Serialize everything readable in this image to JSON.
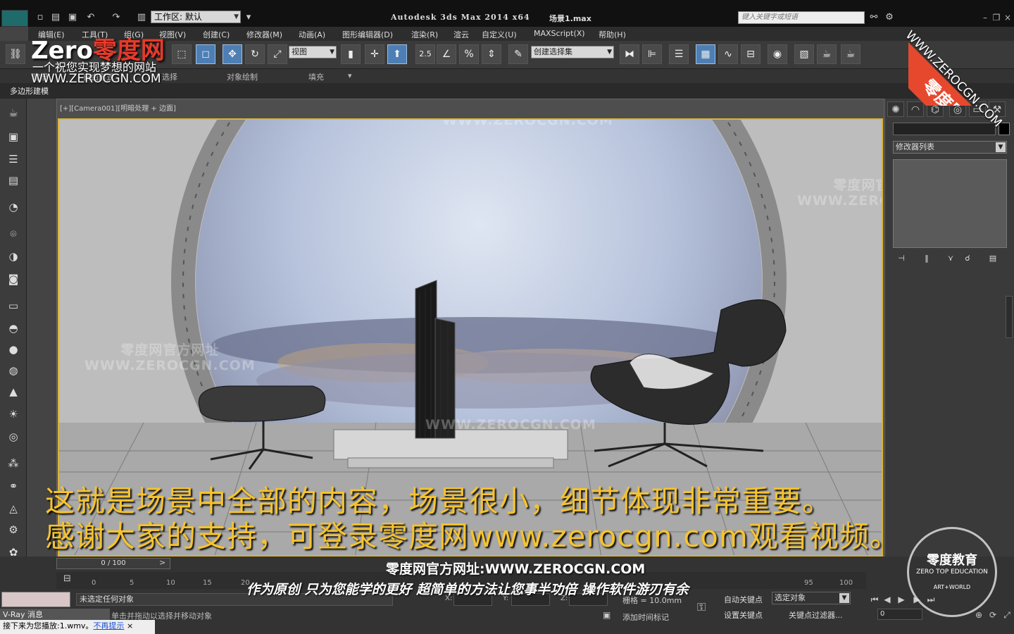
{
  "titlebar": {
    "workspace_label": "工作区: 默认",
    "app_title": "Autodesk 3ds Max  2014 x64",
    "file_name": "场景1.max",
    "search_placeholder": "键入关键字或短语"
  },
  "menu": [
    {
      "label": "编辑(E)"
    },
    {
      "label": "工具(T)"
    },
    {
      "label": "组(G)"
    },
    {
      "label": "视图(V)"
    },
    {
      "label": "创建(C)"
    },
    {
      "label": "修改器(M)"
    },
    {
      "label": "动画(A)"
    },
    {
      "label": "图形编辑器(D)"
    },
    {
      "label": "渲染(R)"
    },
    {
      "label": "渲云"
    },
    {
      "label": "自定义(U)"
    },
    {
      "label": "MAXScript(X)"
    },
    {
      "label": "帮助(H)"
    }
  ],
  "toolbar": {
    "view_dropdown": "视图",
    "selection_set": "创建选择集",
    "snap_value": "2.5"
  },
  "ribbon": {
    "tabs": [
      {
        "label": "建模"
      },
      {
        "label": "自由形式"
      },
      {
        "label": "选择"
      },
      {
        "label": "对象绘制"
      },
      {
        "label": "填充"
      }
    ],
    "sub_label": "多边形建模"
  },
  "viewport": {
    "label": "[+][Camera001][明暗处理 + 边面]",
    "watermark_cn": "零度网官方网址",
    "watermark_en": "WWW.ZEROCGN.COM"
  },
  "overlay": {
    "subtitle_line1": "这就是场景中全部的内容，场景很小，细节体现非常重要。",
    "subtitle_line2": "感谢大家的支持，可登录零度网www.zerocgn.com观看视频。",
    "website": "零度网官方网址:WWW.ZEROCGN.COM",
    "slogan": "作为原创 只为您能学的更好 超简单的方法让您事半功倍 操作软件游刃有余",
    "logo_zero": "Zero",
    "logo_name": "零度网",
    "logo_tagline": "一个祝您实现梦想的网站",
    "logo_url": "WWW.ZEROCGN.COM",
    "corner_badge": "零度原创",
    "corner_url": "WWW.ZEROCGN.COM",
    "seal_title": "零度教育",
    "seal_sub": "ZERO TOP EDUCATION",
    "seal_sub2": "ART+WORLD"
  },
  "command_panel": {
    "modifier_list": "修改器列表"
  },
  "timeline": {
    "slider_label": "0 / 100",
    "ticks": [
      "0",
      "5",
      "10",
      "15",
      "20",
      "95",
      "100"
    ]
  },
  "status": {
    "selection": "未选定任何对象",
    "prompt": "单击并拖动以选择并移动对象",
    "maxscript_tab": "V-Ray 消息",
    "x_label": "X:",
    "y_label": "Y:",
    "z_label": "Z:",
    "grid": "栅格 = 10.0mm",
    "add_time_tag": "添加时间标记",
    "auto_key": "自动关键点",
    "set_key": "设置关键点",
    "selected_object": "选定对象",
    "key_filter": "关键点过滤器...",
    "frame": "0"
  },
  "player": {
    "now_playing": "接下来为您播放:1.wmv。",
    "link": "不再提示",
    "close": "×"
  },
  "colors": {
    "accent": "#d8b43a",
    "subtitle": "#f5c330",
    "badge_red": "#e6482e",
    "active_tool": "#4d7fb5"
  }
}
